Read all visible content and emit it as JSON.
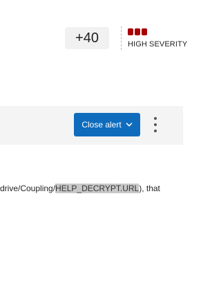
{
  "score": {
    "value": "+40"
  },
  "severity": {
    "label": "HIGH SEVERITY",
    "level_bars": 3,
    "color": "#a80000"
  },
  "command_bar": {
    "close_alert_label": "Close alert",
    "close_alert_icon": "chevron-down-icon",
    "more_icon": "more-vertical-icon",
    "accent_color": "#0f6cbd"
  },
  "detail_text": {
    "before": "drive/Coupling/",
    "highlighted": "HELP_DECRYPT.URL",
    "after": "), that"
  }
}
